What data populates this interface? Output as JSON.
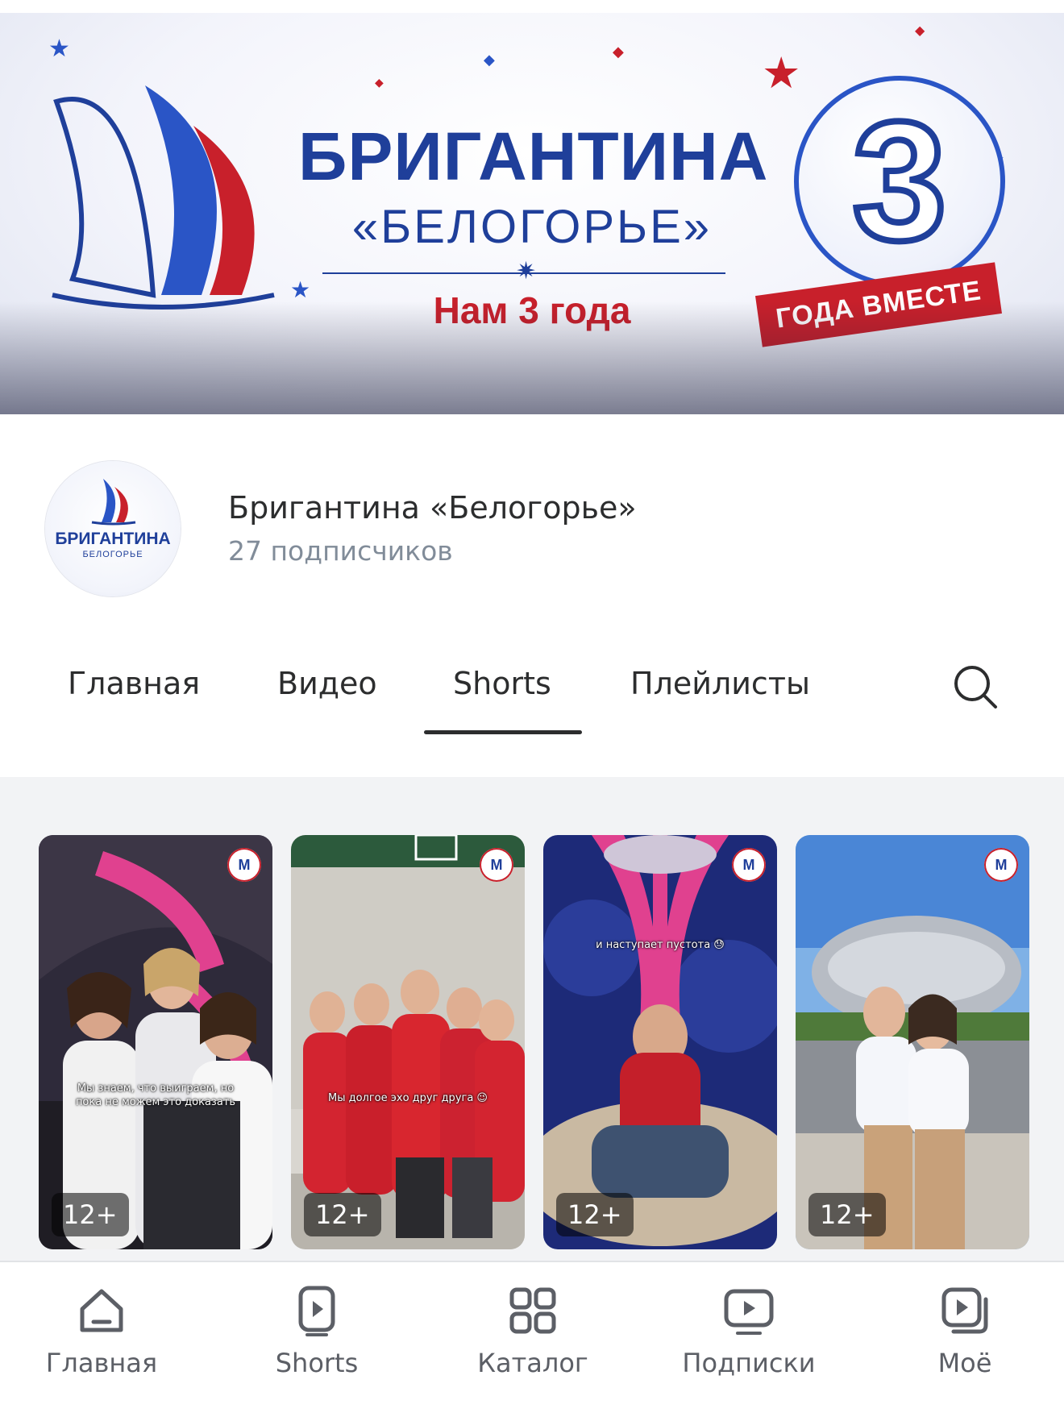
{
  "banner": {
    "title": "БРИГАНТИНА",
    "subtitle": "«БЕЛОГОРЬЕ»",
    "tagline": "Нам 3 года",
    "number": "3",
    "ribbon": "ГОДА ВМЕСТЕ"
  },
  "channel": {
    "avatar_title": "БРИГАНТИНА",
    "avatar_subtitle": "БЕЛОГОРЬЕ",
    "name": "Бригантина «Белогорье»",
    "subscribers": "27 подписчиков"
  },
  "tabs": [
    {
      "label": "Главная"
    },
    {
      "label": "Видео"
    },
    {
      "label": "Shorts",
      "active": true
    },
    {
      "label": "Плейлисты"
    }
  ],
  "shorts": [
    {
      "age": "12+",
      "caption": "Мы знаем, что выиграем, но пока не можем это доказать",
      "channel_mark": "М"
    },
    {
      "age": "12+",
      "caption": "Мы долгое эхо друг друга 😉",
      "channel_mark": "М"
    },
    {
      "age": "12+",
      "caption": "и наступает пустота 😓",
      "channel_mark": "М"
    },
    {
      "age": "12+",
      "caption": "",
      "channel_mark": "М"
    }
  ],
  "bottom_nav": [
    {
      "label": "Главная",
      "icon": "home-icon"
    },
    {
      "label": "Shorts",
      "icon": "shorts-icon"
    },
    {
      "label": "Каталог",
      "icon": "catalog-icon"
    },
    {
      "label": "Подписки",
      "icon": "subscriptions-icon"
    },
    {
      "label": "Моё",
      "icon": "my-videos-icon"
    }
  ],
  "colors": {
    "brand_blue": "#1f3f9a",
    "brand_red": "#c8202b",
    "text_primary": "#2c2d2e",
    "text_secondary": "#818c99"
  }
}
